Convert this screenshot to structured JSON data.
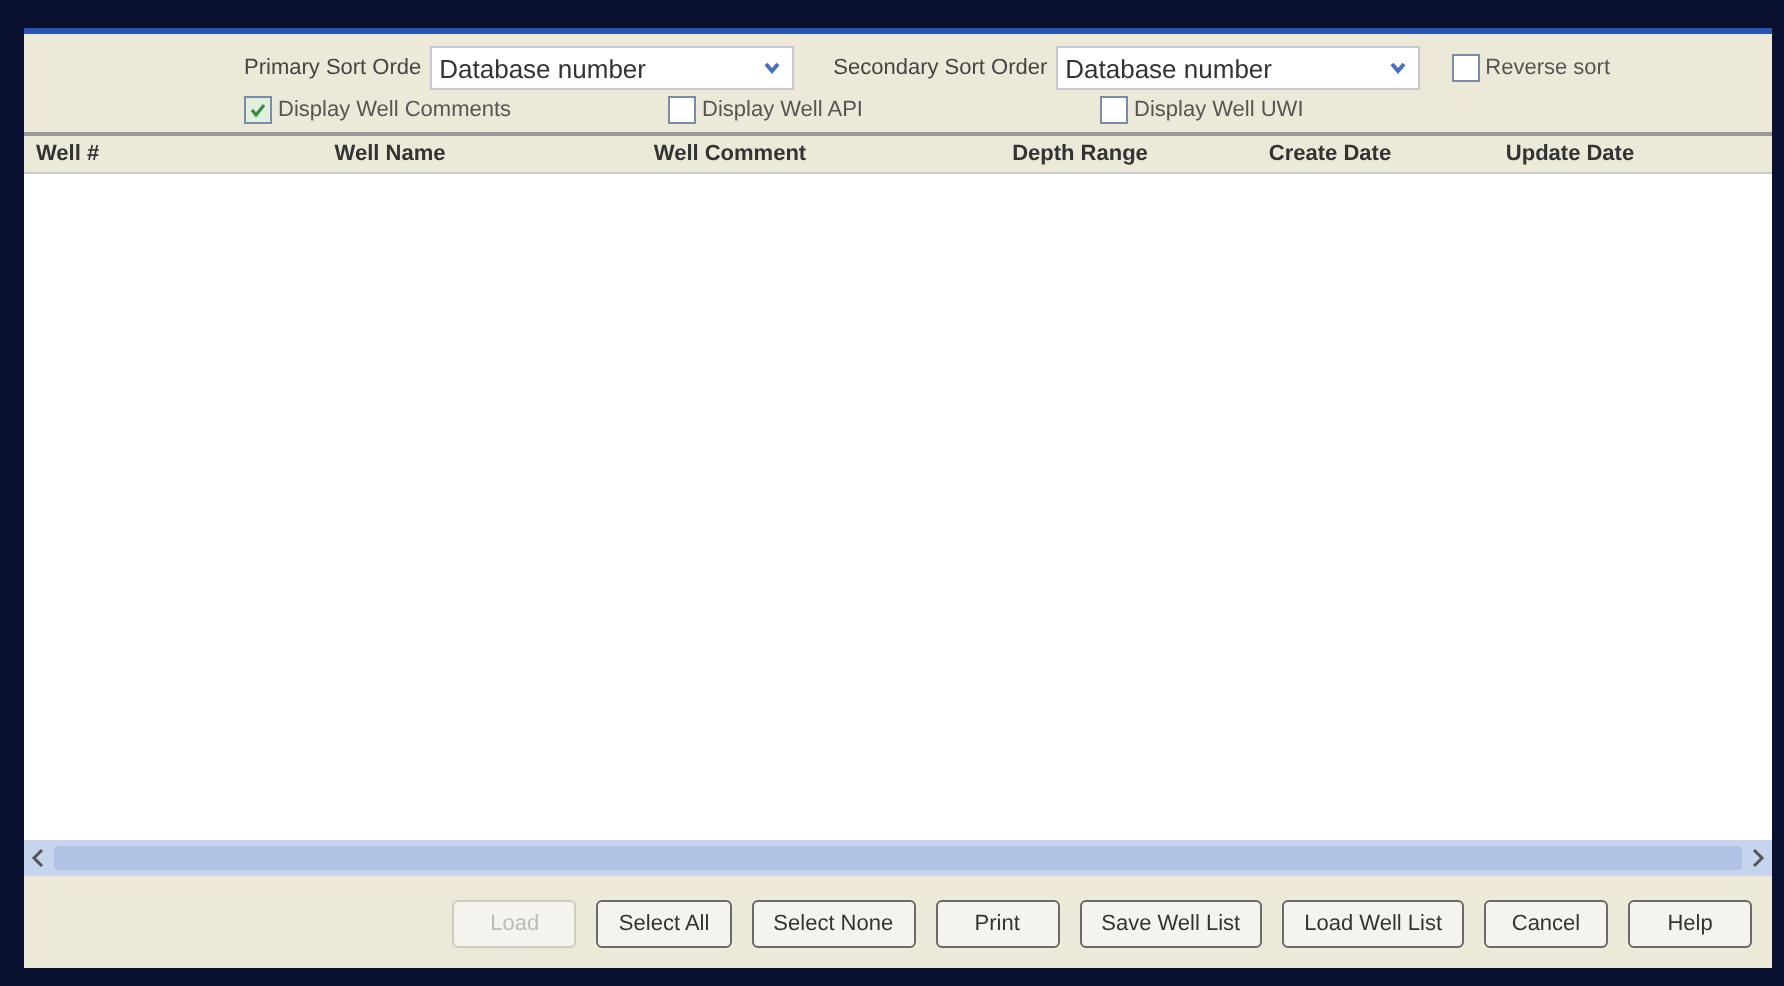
{
  "sort": {
    "primary_label": "Primary Sort Orde",
    "primary_value": "Database number",
    "secondary_label": "Secondary Sort Order",
    "secondary_value": "Database number"
  },
  "options": [
    {
      "label": "Reverse sort",
      "checked": false
    },
    {
      "label": "Display Well Comments",
      "checked": true
    },
    {
      "label": "Display Well API",
      "checked": false
    },
    {
      "label": "Display Well UWI",
      "checked": false
    }
  ],
  "table": {
    "columns": [
      "Well #",
      "Well Name",
      "Well Comment",
      "Depth Range",
      "Create Date",
      "Update Date"
    ]
  },
  "buttons": [
    {
      "label": "Load",
      "disabled": true
    },
    {
      "label": "Select All",
      "disabled": false
    },
    {
      "label": "Select None",
      "disabled": false
    },
    {
      "label": "Print",
      "disabled": false
    },
    {
      "label": "Save Well List",
      "disabled": false
    },
    {
      "label": "Load Well List",
      "disabled": false
    },
    {
      "label": "Cancel",
      "disabled": false
    },
    {
      "label": "Help",
      "disabled": false
    }
  ]
}
